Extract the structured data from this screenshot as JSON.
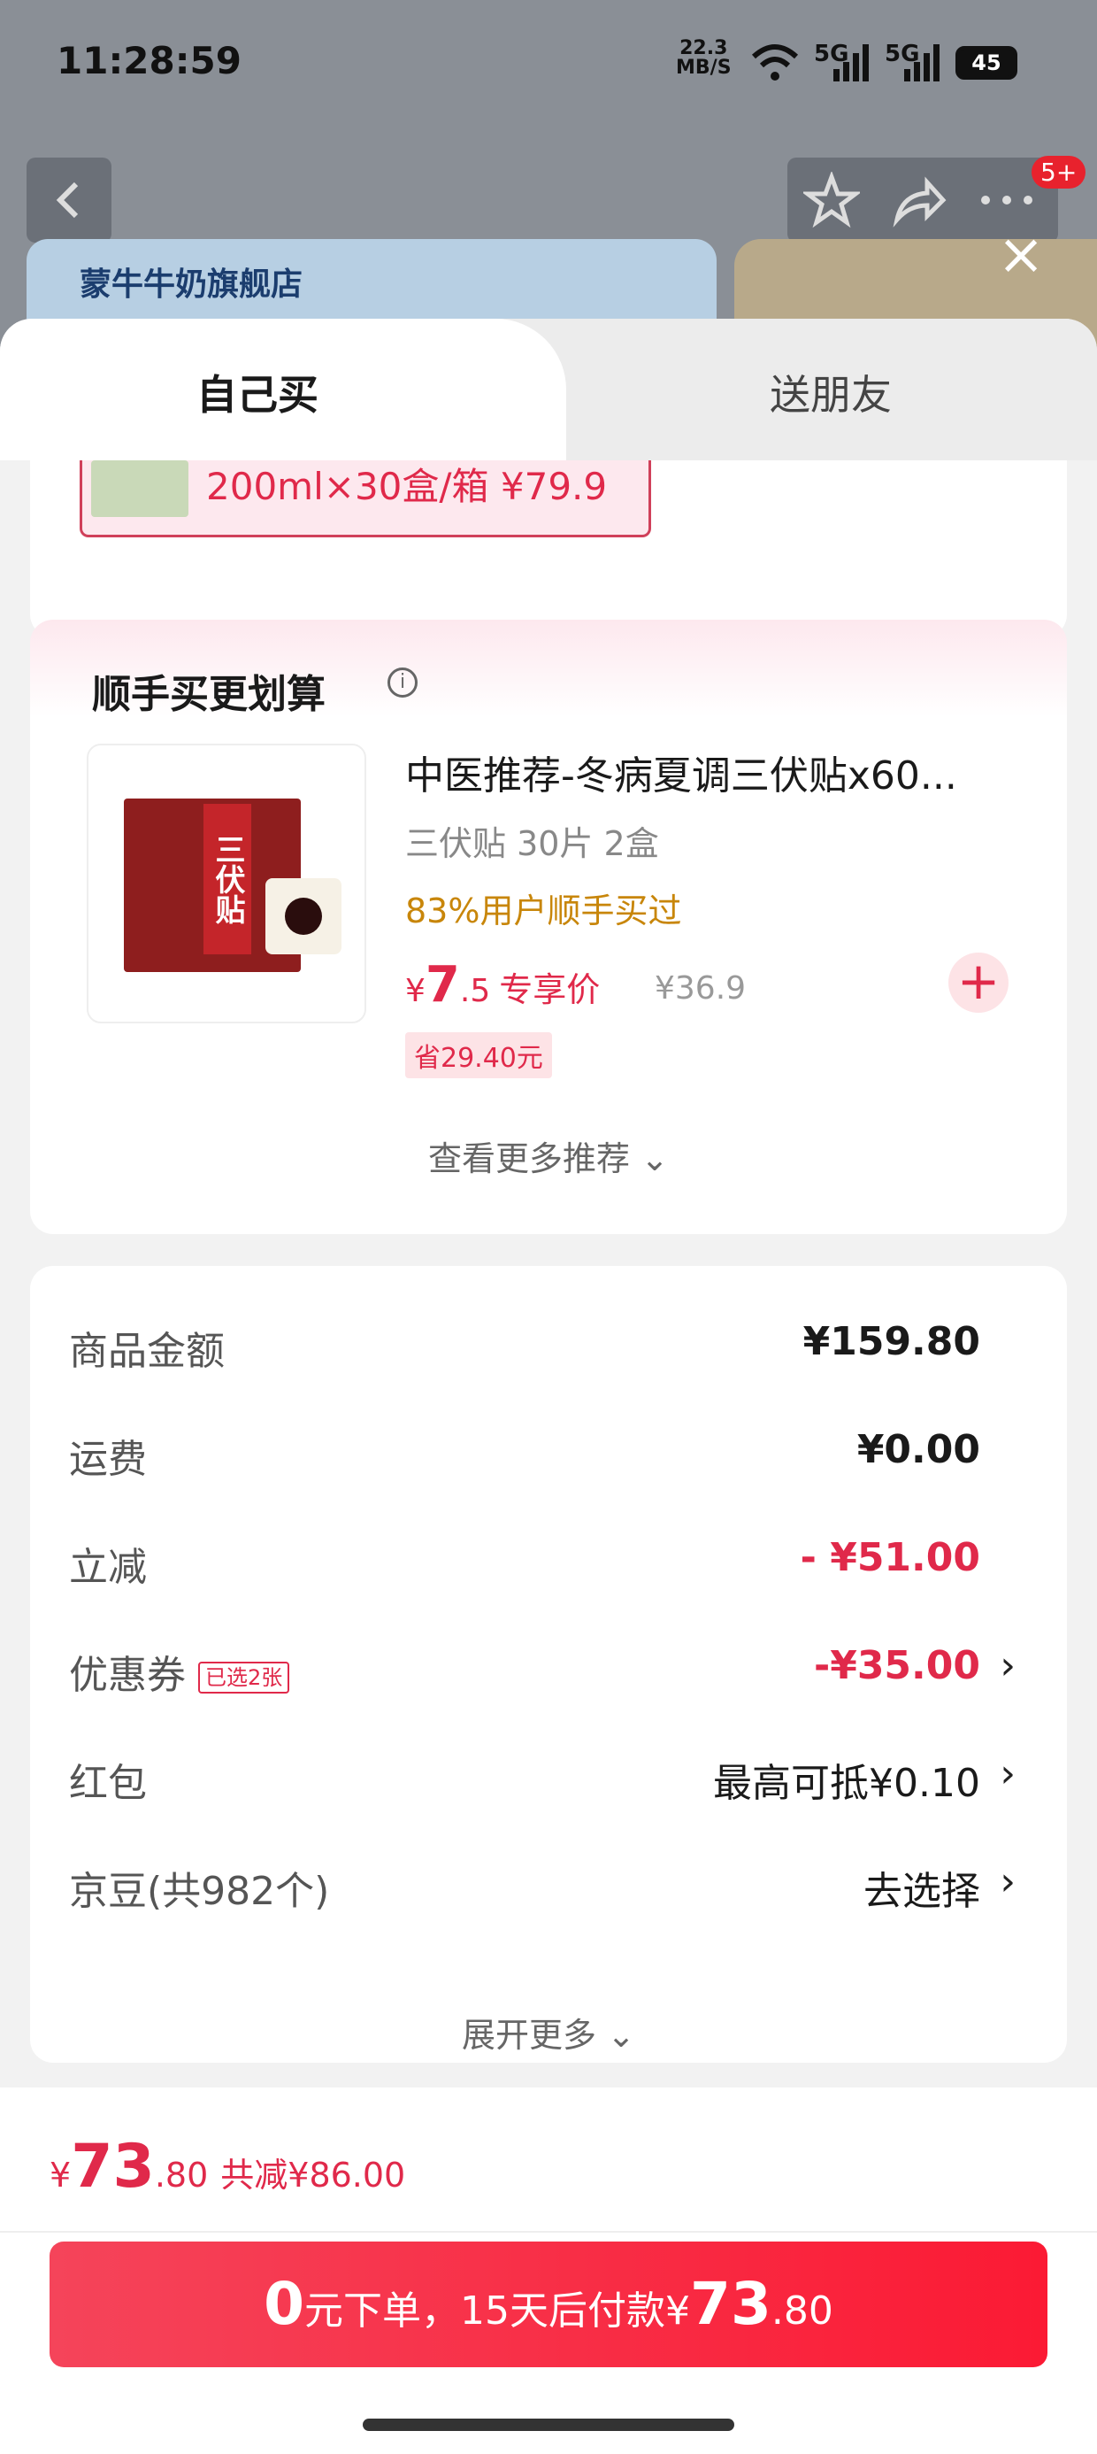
{
  "status_bar": {
    "time": "11:28:59",
    "speed_value": "22.3",
    "speed_unit": "MB/S",
    "net1": "5G",
    "net2": "5G",
    "battery": "45"
  },
  "background": {
    "store_name": "蒙牛牛奶旗舰店",
    "cart_badge": "5+"
  },
  "tabs": {
    "self": "自己买",
    "gift": "送朋友"
  },
  "prev_item": {
    "text": "200ml×30盒/箱  ¥79.9"
  },
  "recommend": {
    "title": "顺手买更划算",
    "product": {
      "box_label": "三伏贴",
      "name": "中医推荐-冬病夏调三伏贴x60...",
      "spec": "三伏贴 30片 2盒",
      "social": "83%用户顺手买过",
      "currency": "¥",
      "price_int": "7",
      "price_dec": ".5",
      "price_tag": "专享价",
      "orig_price": "¥36.9",
      "save": "省29.40元"
    },
    "more": "查看更多推荐 ⌄"
  },
  "summary": {
    "rows": [
      {
        "label": "商品金额",
        "value": "¥159.80"
      },
      {
        "label": "运费",
        "value": "¥0.00"
      },
      {
        "label": "立减",
        "value": "- ¥51.00"
      },
      {
        "label": "优惠券",
        "tag": "已选2张",
        "value": "-¥35.00"
      },
      {
        "label": "红包",
        "value": "最高可抵¥0.10"
      },
      {
        "label": "京豆(共982个)",
        "value": "去选择"
      }
    ],
    "expand": "展开更多 ⌄"
  },
  "bottom": {
    "currency": "¥",
    "total_int": "73",
    "total_dec": ".80",
    "reduce": "共减¥86.00",
    "pay_zero": "0",
    "pay_text_1": "元下单，15天后付款¥",
    "pay_int": "73",
    "pay_dec": ".80"
  }
}
